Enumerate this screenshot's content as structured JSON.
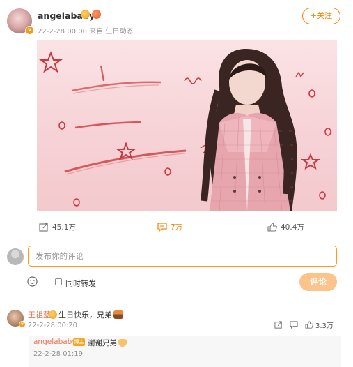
{
  "post": {
    "username": "angelababy",
    "time": "22-2-28 00:00",
    "source": "来自 生日动态",
    "follow_label": "+关注"
  },
  "actions": {
    "repost_count": "45.1万",
    "comment_count": "7万",
    "like_count": "40.4万"
  },
  "compose": {
    "placeholder": "发布你的评论",
    "also_repost_label": "同时转发",
    "submit_label": "评论"
  },
  "comment": {
    "author": "王祖蓝",
    "text": "生日快乐，兄弟",
    "time": "22-2-28 00:20",
    "like_count": "3.3万"
  },
  "reply": {
    "author": "angelababy",
    "author_badge": "博主",
    "text": "谢谢兄弟",
    "time": "22-2-28 01:19"
  },
  "colors": {
    "accent": "#ff8200",
    "link": "#eb7350",
    "image_bg": "#f6d2d6"
  }
}
